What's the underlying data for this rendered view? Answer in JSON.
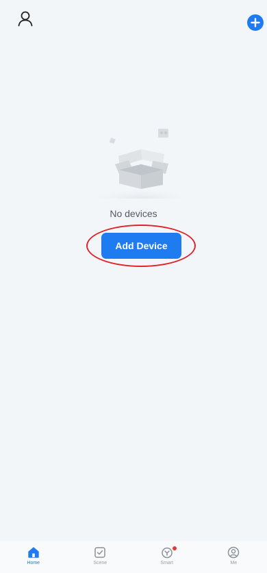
{
  "header": {
    "profile_icon": "user-outline-icon",
    "add_icon": "plus-circle-icon",
    "accent_color": "#1f7cf0"
  },
  "empty_state": {
    "illustration": "open-box-illustration",
    "message": "No devices",
    "add_button_label": "Add Device",
    "highlight_ring_color": "#e0232a"
  },
  "tabs": [
    {
      "label": "Home",
      "icon": "home-icon",
      "active": true
    },
    {
      "label": "Scene",
      "icon": "scene-checkbox-icon",
      "active": false
    },
    {
      "label": "Smart",
      "icon": "smart-shield-icon",
      "active": false,
      "badge": true
    },
    {
      "label": "Me",
      "icon": "me-profile-icon",
      "active": false
    }
  ]
}
